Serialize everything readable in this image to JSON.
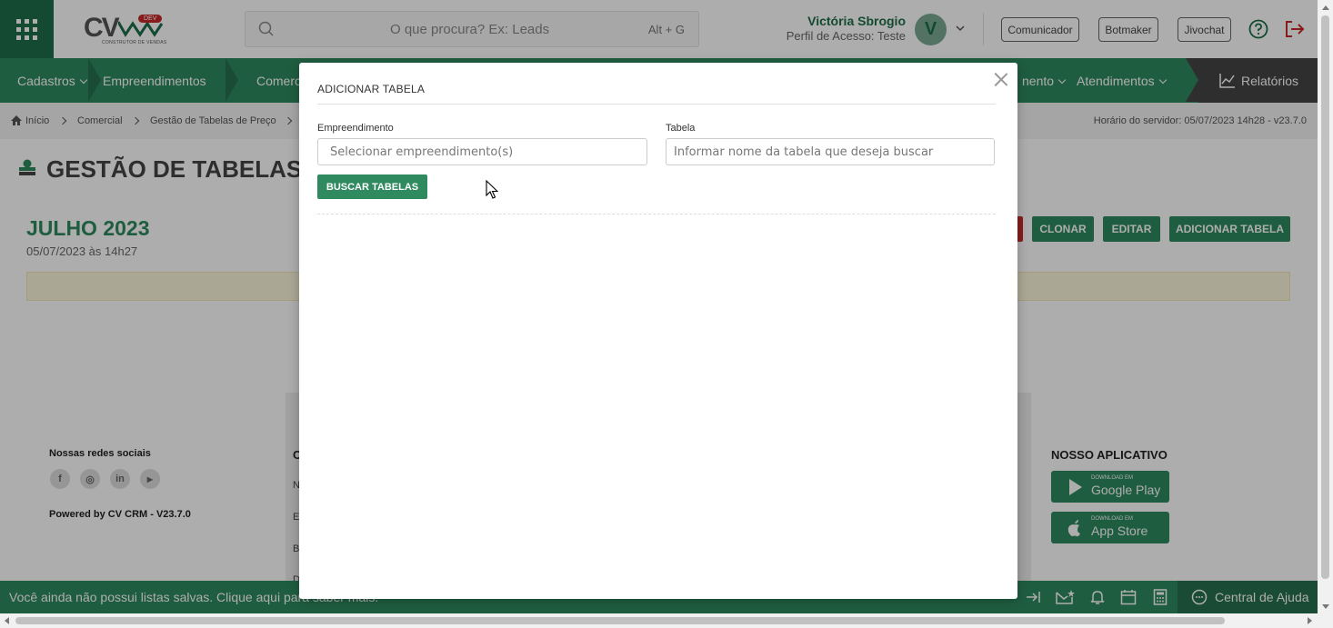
{
  "header": {
    "logo_text": "CV",
    "logo_badge": "DEV",
    "logo_sub": "CONSTRUTOR DE VENDAS",
    "search_placeholder": "O que procura? Ex: Leads",
    "search_shortcut": "Alt + G",
    "user_name": "Victória Sbrogio",
    "user_profile": "Perfil de Acesso: Teste",
    "avatar_initial": "V",
    "buttons": [
      "Comunicador",
      "Botmaker",
      "Jivochat"
    ]
  },
  "nav": {
    "items": [
      "Cadastros",
      "Empreendimentos",
      "Comerc",
      "nento",
      "Atendimentos",
      "Relatórios"
    ]
  },
  "breadcrumb": {
    "items": [
      "Início",
      "Comercial",
      "Gestão de Tabelas de Preço"
    ],
    "server_time": "Horário do servidor: 05/07/2023 14h28 - v23.7.0"
  },
  "page": {
    "title": "GESTÃO DE TABELAS D",
    "month": "JULHO 2023",
    "date": "05/07/2023 às 14h27",
    "actions": [
      "CLONAR",
      "EDITAR",
      "ADICIONAR TABELA"
    ]
  },
  "footer": {
    "social_title": "Nossas redes sociais",
    "social_icons": [
      "f",
      "◎",
      "in",
      "▶"
    ],
    "powered": "Powered by CV CRM - V23.7.0",
    "mid_letters": [
      "C",
      "N",
      "E",
      "B",
      "D"
    ],
    "app_title": "NOSSO APLICATIVO",
    "google_small": "DOWNLOAD EM",
    "google_big": "Google Play",
    "apple_small": "DOWNLOAD EM",
    "apple_big": "App Store"
  },
  "statusbar": {
    "message": "Você ainda não possui listas salvas. Clique aqui para saber mais.",
    "help": "Central de Ajuda"
  },
  "modal": {
    "title": "ADICIONAR TABELA",
    "field1_label": "Empreendimento",
    "field1_placeholder": "Selecionar empreendimento(s)",
    "field2_label": "Tabela",
    "field2_placeholder": "Informar nome da tabela que deseja buscar",
    "search_button": "BUSCAR TABELAS"
  },
  "colors": {
    "brand_green": "#2f8a5f",
    "brand_dark_green": "#1e6e49",
    "danger": "#c92a2a"
  }
}
